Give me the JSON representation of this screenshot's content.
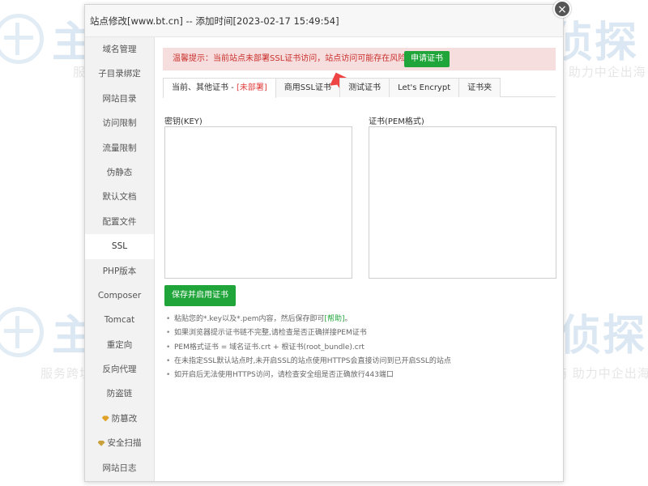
{
  "watermark": {
    "brand": "主机侦探",
    "slogan": "服务跨境电商  助力中企出海"
  },
  "dialog": {
    "title": "站点修改[www.bt.cn] -- 添加时间[2023-02-17 15:49:54]",
    "close_glyph": "×"
  },
  "sidebar": {
    "items": [
      {
        "label": "域名管理"
      },
      {
        "label": "子目录绑定"
      },
      {
        "label": "网站目录"
      },
      {
        "label": "访问限制"
      },
      {
        "label": "流量限制"
      },
      {
        "label": "伪静态"
      },
      {
        "label": "默认文档"
      },
      {
        "label": "配置文件"
      },
      {
        "label": "SSL"
      },
      {
        "label": "PHP版本"
      },
      {
        "label": "Composer"
      },
      {
        "label": "Tomcat"
      },
      {
        "label": "重定向"
      },
      {
        "label": "反向代理"
      },
      {
        "label": "防盗链"
      },
      {
        "label": "防篡改",
        "icon": "orange-gem-icon"
      },
      {
        "label": "安全扫描",
        "icon": "gold-gem-icon"
      },
      {
        "label": "网站日志"
      }
    ],
    "active_index": 8
  },
  "alert": {
    "text": "温馨提示：当前站点未部署SSL证书访问，站点访问可能存在风险。",
    "button_label": "申请证书"
  },
  "tabs": [
    {
      "label": "当前、其他证书 - ",
      "suffix": "[未部署]"
    },
    {
      "label": "商用SSL证书",
      "flag": "red-flag-icon"
    },
    {
      "label": "测试证书"
    },
    {
      "label": "Let's Encrypt"
    },
    {
      "label": "证书夹"
    }
  ],
  "form": {
    "key_label": "密钥(KEY)",
    "cert_label": "证书(PEM格式)",
    "key_value": "",
    "cert_value": "",
    "save_label": "保存并启用证书"
  },
  "tips": [
    {
      "text": "粘贴您的*.key以及*.pem内容，然后保存即可",
      "link": "[帮助]",
      "tail": "。"
    },
    {
      "text": "如果浏览器提示证书链不完整,请检查是否正确拼接PEM证书"
    },
    {
      "text": "PEM格式证书 = 域名证书.crt + 根证书(root_bundle).crt"
    },
    {
      "text": "在未指定SSL默认站点时,未开启SSL的站点使用HTTPS会直接访问到已开启SSL的站点"
    },
    {
      "text": "如开启后无法使用HTTPS访问，请检查安全组是否正确放行443端口"
    }
  ],
  "colors": {
    "accent_green": "#20a53a",
    "alert_bg": "#f7dede",
    "alert_text": "#c9302c",
    "tab_red": "#e23e3e"
  }
}
